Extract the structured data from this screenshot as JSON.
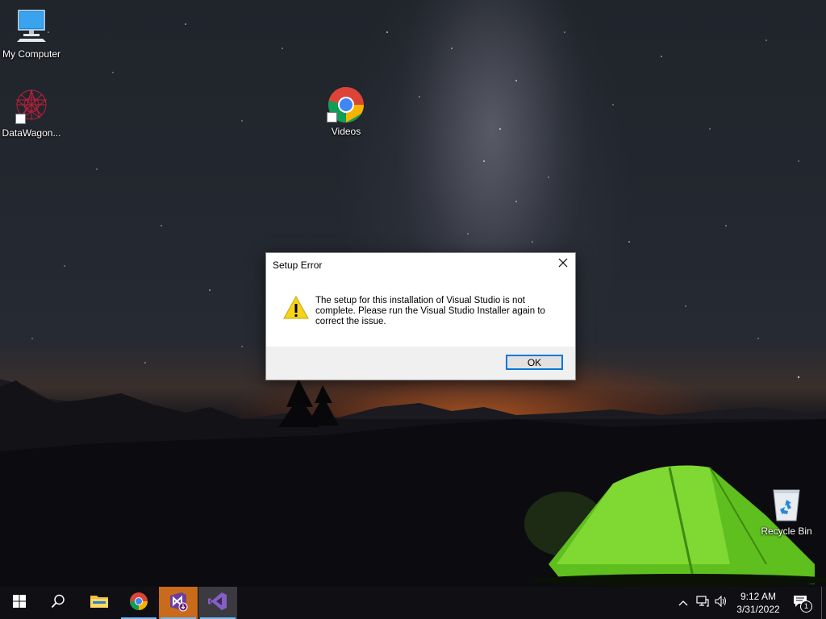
{
  "desktop": {
    "icons": [
      {
        "label": "My Computer",
        "icon": "computer-icon"
      },
      {
        "label": "DataWagon...",
        "icon": "datawagon-shortcut-icon"
      },
      {
        "label": "Videos",
        "icon": "chrome-shortcut-icon"
      },
      {
        "label": "Recycle Bin",
        "icon": "recycle-bin-icon"
      }
    ]
  },
  "dialog": {
    "title": "Setup Error",
    "message": "The setup for this installation of Visual Studio is not complete. Please run the Visual Studio Installer again to correct the issue.",
    "ok_label": "OK",
    "icon": "warning-icon"
  },
  "taskbar": {
    "items": [
      {
        "name": "start",
        "icon": "windows-start-icon"
      },
      {
        "name": "search",
        "icon": "search-icon"
      },
      {
        "name": "file-explorer",
        "icon": "folder-icon"
      },
      {
        "name": "chrome",
        "icon": "chrome-icon"
      },
      {
        "name": "visual-studio-installer",
        "icon": "vs-installer-icon"
      },
      {
        "name": "visual-studio",
        "icon": "visual-studio-icon"
      }
    ],
    "tray": {
      "time": "9:12 AM",
      "date": "3/31/2022",
      "notification_count": "1"
    }
  },
  "colors": {
    "accent": "#0078d7",
    "taskbar": "#101014",
    "active_app": "#c96b1a",
    "warning": "#f7d417"
  }
}
